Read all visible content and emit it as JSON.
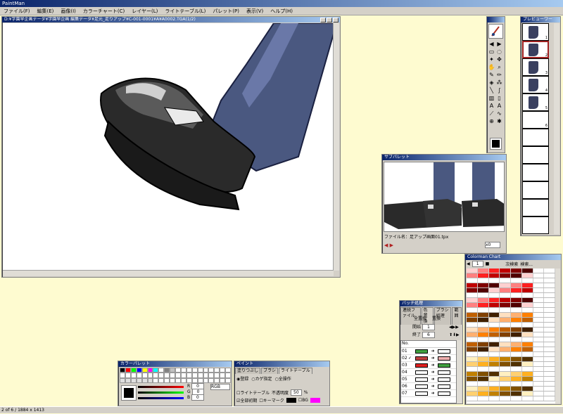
{
  "app": {
    "title": "PaintMan",
    "title_color": "#0a246a"
  },
  "menu": [
    "ファイル(F)",
    "編集(E)",
    "画像(I)",
    "カラーチャート(C)",
    "レイヤー(L)",
    "ライトテーブル(L)",
    "パレット(P)",
    "表示(V)",
    "ヘルプ(H)"
  ],
  "canvas_window": {
    "title": "D:¥学園早企画データ¥学園早企画 編集データ¥足元_走りアップ¥C-001-0001¥A¥A0002.TGA(1/2)"
  },
  "toolbox": {
    "title": "",
    "tools": [
      "brush-tool",
      "arrow-left-icon",
      "arrow-right-icon",
      "rect-select",
      "lasso-select",
      "magic-wand",
      "move",
      "hand",
      "zoom",
      "pen",
      "pencil",
      "fill",
      "airbrush",
      "line",
      "curve",
      "gradient",
      "eraser",
      "text-a",
      "text-b",
      "eyedropper",
      "smudge",
      "stamp",
      "swap-icon"
    ],
    "current_color": "#000000"
  },
  "preview": {
    "title": "プレビューワー",
    "frames": [
      "1",
      "2",
      "3",
      "4",
      "5",
      "6"
    ],
    "selected": "2"
  },
  "subpalette": {
    "title": "サブパレット",
    "file_label": "ファイル名：",
    "file_name": "足アップ画面01.tpx",
    "zoom": "x0"
  },
  "colorchart": {
    "title": "Colorman Chart",
    "page": "1",
    "next_search": "次検索",
    "search": "検索..."
  },
  "batch": {
    "title": "バッチ処理",
    "tabs": [
      "連続ファイル",
      "色置換",
      "ブラシ処理",
      "範囲"
    ],
    "replace_all": "全置換",
    "replace": "置換",
    "start_label": "開始",
    "start_value": "1",
    "end_label": "終了",
    "end_value": "6",
    "no_label": "No.",
    "rows": [
      {
        "no": "01",
        "from": "#40a040",
        "to": "#ffffff"
      },
      {
        "no": "02",
        "from": "#c04040",
        "to": "#f0b0b0"
      },
      {
        "no": "03",
        "from": "#e02020",
        "to": "#40a040"
      },
      {
        "no": "04",
        "from": "#ffffff",
        "to": "#ffffff"
      },
      {
        "no": "05",
        "from": "#ffffff",
        "to": "#ffffff"
      },
      {
        "no": "06",
        "from": "#ffffff",
        "to": "#ffffff"
      },
      {
        "no": "07",
        "from": "#ffffff",
        "to": "#ffffff"
      }
    ]
  },
  "colorpalette": {
    "title": "カラーパレット",
    "r_label": "R",
    "g_label": "G",
    "b_label": "B",
    "r_value": "0",
    "g_value": "0",
    "b_value": "0",
    "mode": "RGB",
    "swatch": "#000000",
    "colors": [
      "#000000",
      "#ff0000",
      "#00ff00",
      "#0000ff",
      "#ffff00",
      "#ff00ff",
      "#00ffff",
      "#ffffff",
      "#808080",
      "#c0c0c0"
    ]
  },
  "paint": {
    "title": "ペイント",
    "tabs": [
      "塗りつぶし",
      "ブラシ",
      "ライトテーブル"
    ],
    "opt1": "登録",
    "opt2": "カゲ指定",
    "opt3": "全操作",
    "cb1": "ライトテーブル",
    "opacity_label": "不透明度",
    "opacity_value": "50",
    "pct": "%",
    "cb2": "全部初期",
    "cb3": "キーマーク",
    "bg_label": "BG"
  },
  "status": {
    "text": "2 of 6 / 1884 x 1413"
  }
}
